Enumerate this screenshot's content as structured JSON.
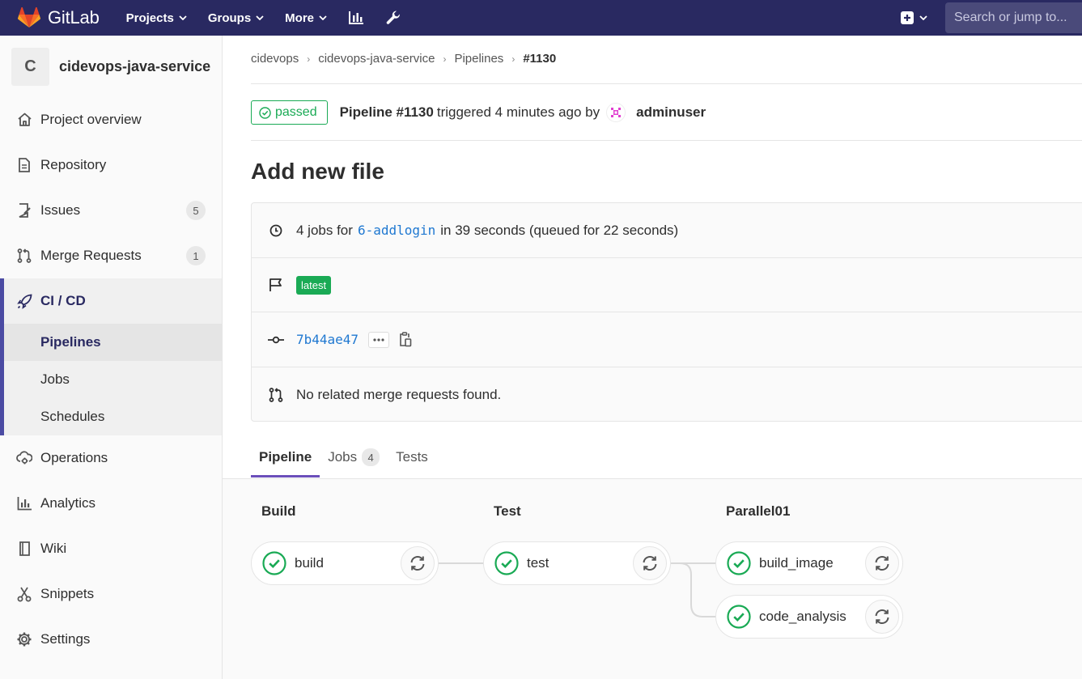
{
  "topbar": {
    "brand": "GitLab",
    "nav": [
      "Projects",
      "Groups",
      "More"
    ],
    "search_placeholder": "Search or jump to..."
  },
  "sidebar": {
    "project_initial": "C",
    "project_name": "cidevops-java-service",
    "items": [
      {
        "label": "Project overview",
        "icon": "home-icon"
      },
      {
        "label": "Repository",
        "icon": "doc-icon"
      },
      {
        "label": "Issues",
        "icon": "issues-icon",
        "count": "5"
      },
      {
        "label": "Merge Requests",
        "icon": "merge-request-icon",
        "count": "1"
      }
    ],
    "cicd": {
      "label": "CI / CD",
      "icon": "rocket-icon",
      "sub": [
        "Pipelines",
        "Jobs",
        "Schedules"
      ],
      "active_sub": "Pipelines"
    },
    "items_after": [
      {
        "label": "Operations",
        "icon": "cloud-gear-icon"
      },
      {
        "label": "Analytics",
        "icon": "chart-icon"
      },
      {
        "label": "Wiki",
        "icon": "book-icon"
      },
      {
        "label": "Snippets",
        "icon": "scissors-icon"
      },
      {
        "label": "Settings",
        "icon": "gear-icon"
      }
    ]
  },
  "breadcrumb": [
    "cidevops",
    "cidevops-java-service",
    "Pipelines",
    "#1130"
  ],
  "pipeline": {
    "status": "passed",
    "label": "Pipeline #1130",
    "triggered": "triggered 4 minutes ago by",
    "user": "adminuser",
    "title": "Add new file",
    "jobs_prefix": "4 jobs for",
    "branch": "6-addlogin",
    "duration": "in 39 seconds (queued for 22 seconds)",
    "tag": "latest",
    "commit": "7b44ae47",
    "mr_text": "No related merge requests found."
  },
  "tabs": [
    {
      "label": "Pipeline",
      "active": true
    },
    {
      "label": "Jobs",
      "count": "4"
    },
    {
      "label": "Tests"
    }
  ],
  "stages": [
    {
      "name": "Build",
      "jobs": [
        "build"
      ]
    },
    {
      "name": "Test",
      "jobs": [
        "test"
      ]
    },
    {
      "name": "Parallel01",
      "jobs": [
        "build_image",
        "code_analysis"
      ]
    }
  ],
  "colors": {
    "topbar": "#292961",
    "success": "#1aaa55",
    "link": "#1f78d1",
    "active_tab": "#6b4fbb"
  }
}
